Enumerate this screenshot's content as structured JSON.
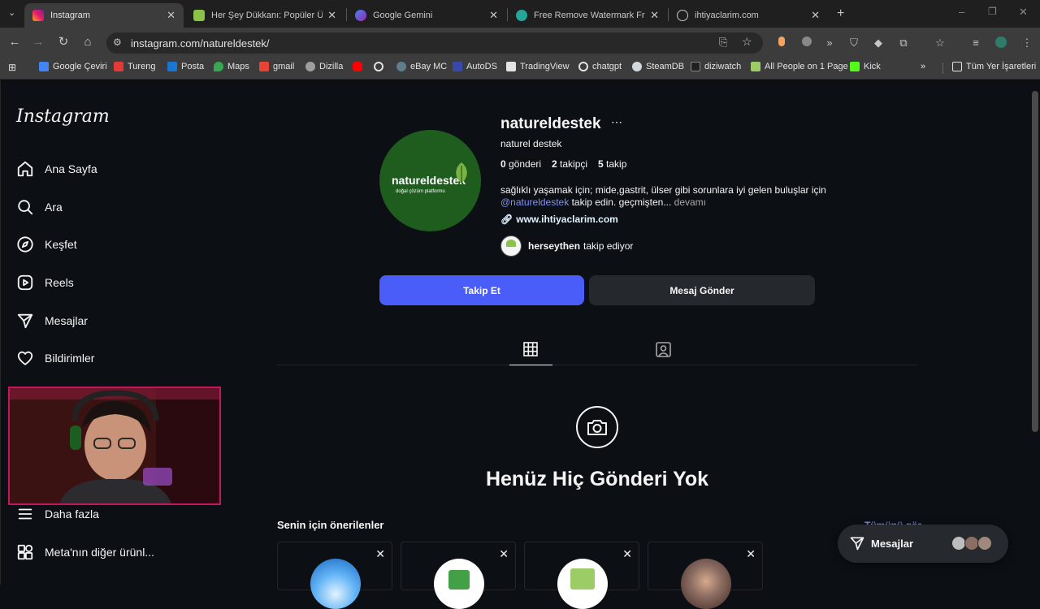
{
  "tabs": [
    {
      "title": "Instagram",
      "active": true
    },
    {
      "title": "Her Şey Dükkanı: Popüler Ürünl",
      "active": false
    },
    {
      "title": "Google Gemini",
      "active": false
    },
    {
      "title": "Free Remove Watermark From",
      "active": false
    },
    {
      "title": "ihtiyaclarim.com",
      "active": false
    }
  ],
  "address_bar": {
    "url": "instagram.com/natureldestek/"
  },
  "bookmarks": [
    "Google Çeviri",
    "Tureng",
    "Posta",
    "Maps",
    "gmail",
    "Dizilla",
    "",
    "",
    "eBay MC",
    "AutoDS",
    "TradingView",
    "chatgpt",
    "SteamDB",
    "diziwatch",
    "All People on 1 Page",
    "Kick"
  ],
  "bookmarks_all": "Tüm Yer İşaretleri",
  "sidebar": {
    "logo": "Instagram",
    "items": [
      {
        "label": "Ana Sayfa",
        "icon": "home-icon"
      },
      {
        "label": "Ara",
        "icon": "search-icon"
      },
      {
        "label": "Keşfet",
        "icon": "compass-icon"
      },
      {
        "label": "Reels",
        "icon": "reels-icon"
      },
      {
        "label": "Mesajlar",
        "icon": "send-icon"
      },
      {
        "label": "Bildirimler",
        "icon": "heart-icon"
      }
    ],
    "more": "Daha fazla",
    "meta": "Meta'nın diğer ürünl..."
  },
  "profile": {
    "username": "natureldestek",
    "name": "naturel destek",
    "avatar_text": "natureldestek",
    "avatar_subtext": "doğal çözüm platformu",
    "stats": {
      "posts": "0",
      "posts_label": "gönderi",
      "followers": "2",
      "followers_label": "takipçi",
      "following": "5",
      "following_label": "takip"
    },
    "bio_line1": "sağlıklı yaşamak için; mide,gastrit, ülser gibi sorunlara iyi gelen buluşlar için",
    "bio_mention": "@natureldestek",
    "bio_line2": "takip edin. geçmişten...",
    "bio_more": "devamı",
    "link": "www.ihtiyaclarim.com",
    "followed_by_user": "herseythen",
    "followed_by_text": "takip ediyor",
    "follow_button": "Takip Et",
    "message_button": "Mesaj Gönder"
  },
  "empty_state": {
    "title": "Henüz Hiç Gönderi Yok"
  },
  "suggestions": {
    "title": "Senin için önerilenler",
    "see_all": "Tümünü gör"
  },
  "messages_bar": {
    "label": "Mesajlar"
  },
  "colors": {
    "accent": "#4a5df9",
    "link": "#e0f1ff",
    "mention": "#7f8ff7",
    "avatar_bg": "#1e5d1e"
  }
}
